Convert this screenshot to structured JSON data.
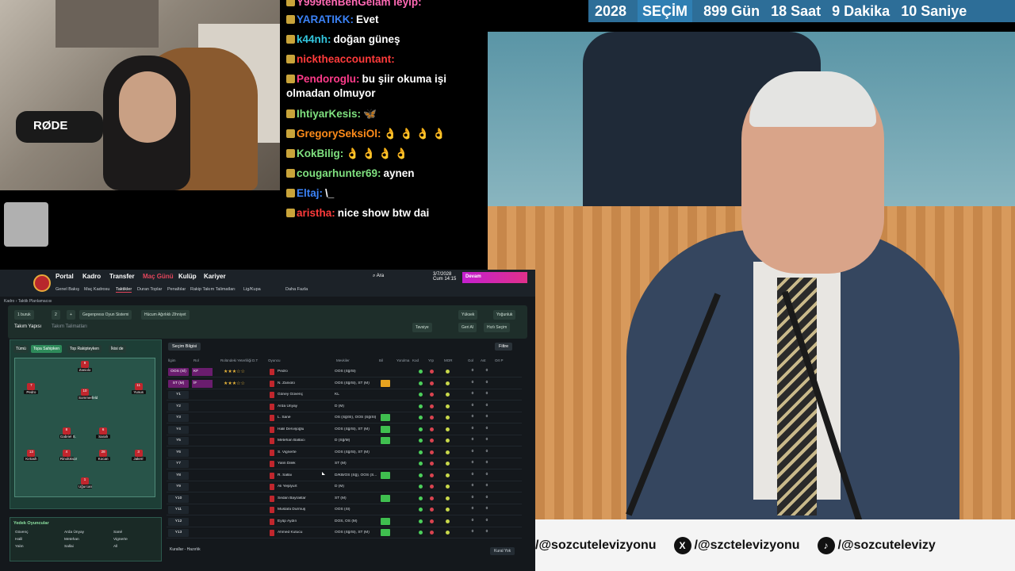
{
  "webcam": {
    "mic_brand": "RØDE"
  },
  "chat": [
    {
      "user": "Y999tehBenGelam leyip:",
      "color": "#ff69b4",
      "text": ""
    },
    {
      "user": "YARATIKK:",
      "color": "#3b82f6",
      "text": "Evet"
    },
    {
      "user": "k44nh:",
      "color": "#33c8e0",
      "text": "doğan güneş"
    },
    {
      "user": "nicktheaccountant:",
      "color": "#ff3b3b",
      "text": ""
    },
    {
      "user": "Pendoroglu:",
      "color": "#ff3b8a",
      "text": "bu şiir okuma işi olmadan olmuyor"
    },
    {
      "user": "IhtiyarKesis:",
      "color": "#7fe07f",
      "text": "🦋"
    },
    {
      "user": "GregorySeksiOl:",
      "color": "#ff8c1a",
      "text": "👌 👌 👌 👌"
    },
    {
      "user": "KokBilig:",
      "color": "#7fe07f",
      "text": "👌 👌 👌 👌"
    },
    {
      "user": "cougarhunter69:",
      "color": "#7fe07f",
      "text": "aynen"
    },
    {
      "user": "Eltaj:",
      "color": "#3b82f6",
      "text": "\\_"
    },
    {
      "user": "aristha:",
      "color": "#ff3b3b",
      "text": "nice show btw dai"
    }
  ],
  "countdown": {
    "year": "2028",
    "label": "SEÇİM",
    "days": "899 Gün",
    "hours": "18 Saat",
    "minutes": "9 Dakika",
    "seconds": "10 Saniye"
  },
  "social": {
    "youtube": "/@sozcutelevizyonu",
    "x": "/@szctelevizyonu",
    "tiktok": "/@sozcutelevizy"
  },
  "fm": {
    "nav": [
      "Portal",
      "Kadro",
      "Transfer",
      "Maç Günü",
      "Kulüp",
      "Kariyer"
    ],
    "subnav": [
      "Genel Bakış",
      "Maç Kadrosu",
      "Taktikler",
      "Duran Toplar",
      "Penaltılar",
      "Rakip Takım Talimatları",
      "Lig/Kupa",
      "Daha Fazla"
    ],
    "date": "3/7/2028",
    "date_sub": "Cum 14:15",
    "continue": "Devam",
    "search": "Ara",
    "breadcrumb": "Kadro  ›  Taktik Planlamacısı",
    "tactic_tabs": [
      "Takım Yapısı",
      "Takım Talimatları"
    ],
    "pills": [
      "1 buruk",
      "2",
      "+",
      "Gegenpress  Oyun Sistemi",
      "Hücum Ağırlıklı  Zihniyet",
      "Yüksek",
      "Yoğunluk",
      "Tavsiye",
      "Geri Al",
      "Hızlı Seçim"
    ],
    "formation_tabs": [
      "Tümü",
      "Topa Sahipken",
      "Top Rakipteyken",
      "İkisi de"
    ],
    "selection": "Seçim Bilgisi",
    "filter": "Filtre",
    "columns": [
      "İlgim",
      "Rol",
      "Rolündeki Yeterliliği",
      "D.T",
      "Oyuncu",
      "Mevkiler",
      "Bil",
      "Yorulma",
      "Kod",
      "Yrp",
      "MOR",
      "Gol",
      "Ast",
      "Ort P"
    ],
    "rows": [
      {
        "pos": "OOS (Sİ)",
        "role": "KF",
        "name": "Pedro",
        "posn": "OOS (Sğ/Sl)"
      },
      {
        "pos": "ST (M)",
        "role": "İF",
        "name": "N. Zaniolo",
        "posn": "OOS (Sğ/Sl), ST (M)"
      },
      {
        "pos": "Y1",
        "role": "",
        "name": "Güney Güvenç",
        "posn": "KL"
      },
      {
        "pos": "Y2",
        "role": "",
        "name": "Arda Ünyay",
        "posn": "D (M)"
      },
      {
        "pos": "Y3",
        "role": "",
        "name": "L. Sané",
        "posn": "OS (Sğ/Sl), OOS (Sğ/Sl)"
      },
      {
        "pos": "Y4",
        "role": "",
        "name": "Halil Dervişoğlu",
        "posn": "OOS (Sğ/Sl), ST (M)"
      },
      {
        "pos": "Y5",
        "role": "",
        "name": "Metehan Baltacı",
        "posn": "D (Sğ/M)"
      },
      {
        "pos": "Y6",
        "role": "",
        "name": "S. Vignerte",
        "posn": "OOS (Sğ/Sl), ST (M)"
      },
      {
        "pos": "Y7",
        "role": "",
        "name": "Yalın Dilek",
        "posn": "ST (M)"
      },
      {
        "pos": "Y8",
        "role": "",
        "name": "R. Sallai",
        "posn": "D/KB/OS (Sğ), OOS (S..."
      },
      {
        "pos": "Y9",
        "role": "",
        "name": "Ali Yeşilyurt",
        "posn": "D (M)"
      },
      {
        "pos": "Y10",
        "role": "",
        "name": "Sedan Bayraktar",
        "posn": "ST (M)"
      },
      {
        "pos": "Y11",
        "role": "",
        "name": "Mustafa Durmuş",
        "posn": "OOS (Sl)"
      },
      {
        "pos": "Y12",
        "role": "",
        "name": "Eyüp Aydın",
        "posn": "DOS, OS (M)"
      },
      {
        "pos": "Y13",
        "role": "",
        "name": "Ahmed Kutucu",
        "posn": "OOS (Sğ/Sl), ST (M)"
      }
    ],
    "subs_title": "Yedek Oyuncular",
    "subs": [
      "Güvenç",
      "Arda Ünyay",
      "Sané",
      "Halil",
      "Metehan",
      "Vignerte",
      "Yalın",
      "Sallai",
      "All"
    ],
    "footer": "Kurallar - Hazırlık",
    "footer_right": "Kural Yok",
    "players": [
      {
        "name": "Zaniolo",
        "num": "9"
      },
      {
        "name": "Pedro",
        "num": "7"
      },
      {
        "name": "Sommerfeld",
        "num": "10"
      },
      {
        "name": "Yunus",
        "num": "11"
      },
      {
        "name": "Gabriel S.",
        "num": "8"
      },
      {
        "name": "Sarah",
        "num": "6"
      },
      {
        "name": "Kırtash",
        "num": "13"
      },
      {
        "name": "Rinolüksor",
        "num": "4"
      },
      {
        "name": "Kocan",
        "num": "28"
      },
      {
        "name": "Jakerr",
        "num": "3"
      },
      {
        "name": "Uğurcan",
        "num": "1"
      }
    ]
  }
}
